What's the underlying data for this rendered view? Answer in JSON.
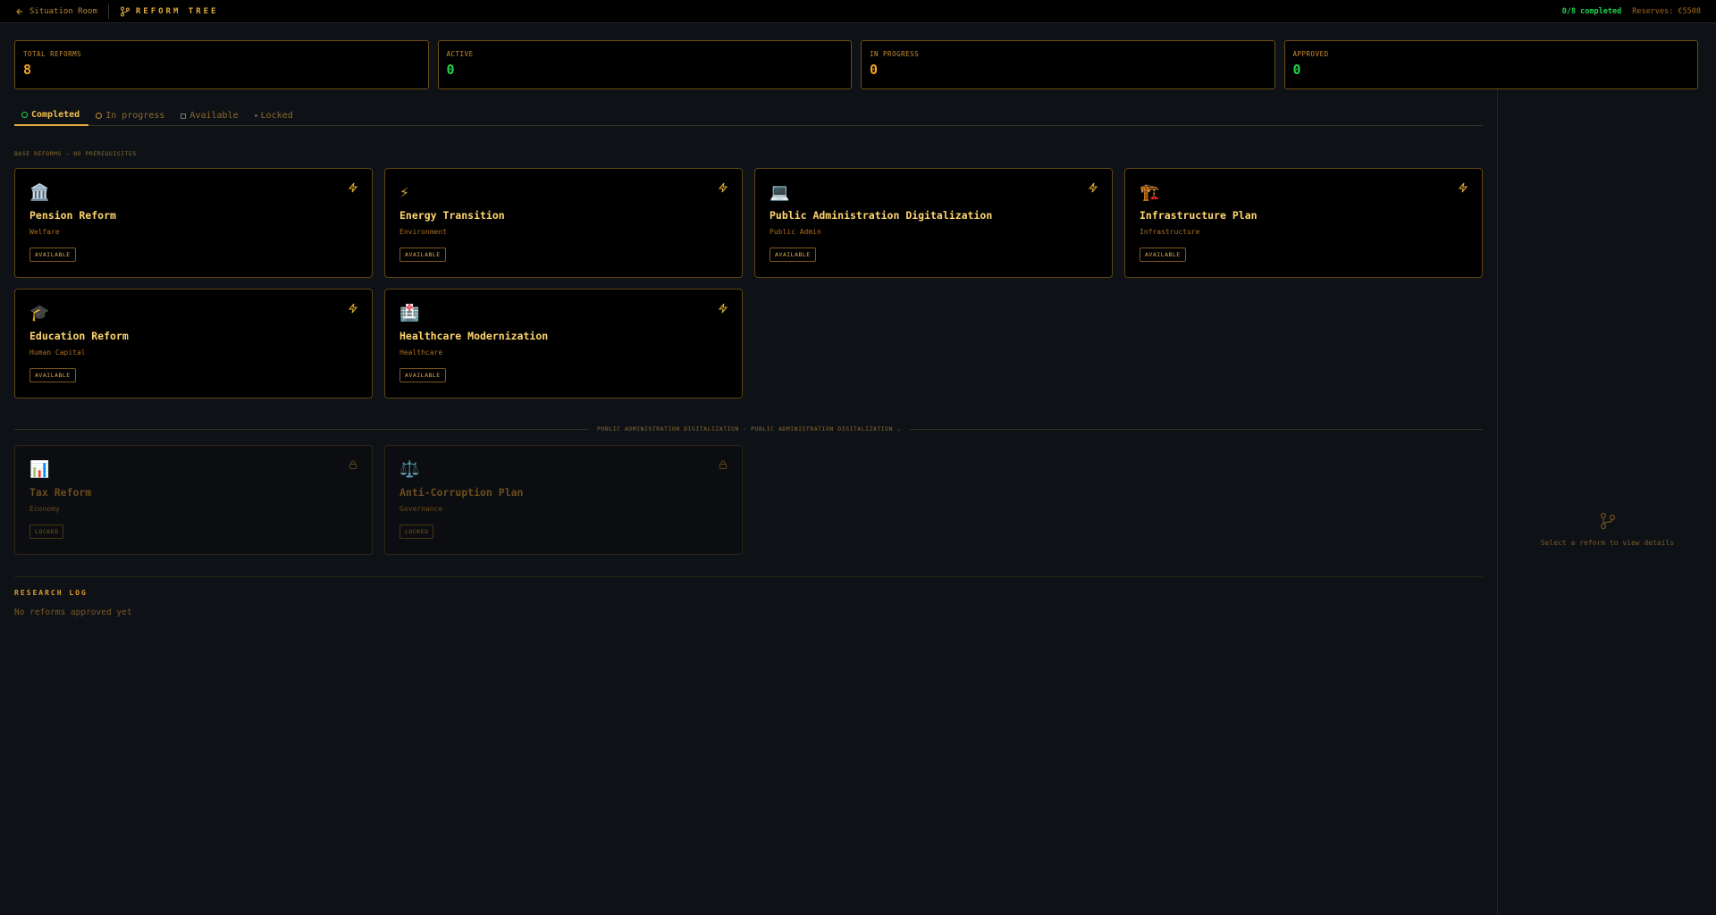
{
  "header": {
    "back_label": "Situation Room",
    "title": "REFORM TREE",
    "completed": "0/8 completed",
    "reserves": "Reserves: €5508"
  },
  "stats": [
    {
      "label": "TOTAL REFORMS",
      "value": "8",
      "color": "#f5a623"
    },
    {
      "label": "ACTIVE",
      "value": "0",
      "color": "#22d34a"
    },
    {
      "label": "IN PROGRESS",
      "value": "0",
      "color": "#f5a623"
    },
    {
      "label": "APPROVED",
      "value": "0",
      "color": "#22d34a"
    }
  ],
  "tabs": [
    {
      "label": "Completed",
      "icon": "check-circle-icon"
    },
    {
      "label": "In progress",
      "icon": "clock-icon"
    },
    {
      "label": "Available",
      "icon": "square-icon"
    },
    {
      "label": "Locked",
      "icon": "dot-icon"
    }
  ],
  "base_section_label": "BASE REFORMS — NO PREREQUISITES",
  "base_reforms": [
    {
      "icon": "🏛️",
      "icon_name": "bank-icon",
      "title": "Pension Reform",
      "category": "Welfare",
      "status": "AVAILABLE"
    },
    {
      "icon": "⚡",
      "icon_name": "lightning-icon",
      "title": "Energy Transition",
      "category": "Environment",
      "status": "AVAILABLE"
    },
    {
      "icon": "💻",
      "icon_name": "laptop-icon",
      "title": "Public Administration Digitalization",
      "category": "Public Admin",
      "status": "AVAILABLE"
    },
    {
      "icon": "🏗️",
      "icon_name": "crane-icon",
      "title": "Infrastructure Plan",
      "category": "Infrastructure",
      "status": "AVAILABLE"
    },
    {
      "icon": "🎓",
      "icon_name": "graduation-cap-icon",
      "title": "Education Reform",
      "category": "Human Capital",
      "status": "AVAILABLE"
    },
    {
      "icon": "🏥",
      "icon_name": "hospital-icon",
      "title": "Healthcare Modernization",
      "category": "Healthcare",
      "status": "AVAILABLE"
    }
  ],
  "dependency_label": "PUBLIC ADMINISTRATION DIGITALIZATION · PUBLIC ADMINISTRATION DIGITALIZATION ⌄",
  "locked_reforms": [
    {
      "icon": "📊",
      "icon_name": "bar-chart-icon",
      "title": "Tax Reform",
      "category": "Economy",
      "status": "LOCKED"
    },
    {
      "icon": "⚖️",
      "icon_name": "scales-icon",
      "title": "Anti-Corruption Plan",
      "category": "Governance",
      "status": "LOCKED"
    }
  ],
  "research_log": {
    "title": "RESEARCH LOG",
    "empty": "No reforms approved yet"
  },
  "side_panel": {
    "empty_text": "Select a reform to view details"
  }
}
